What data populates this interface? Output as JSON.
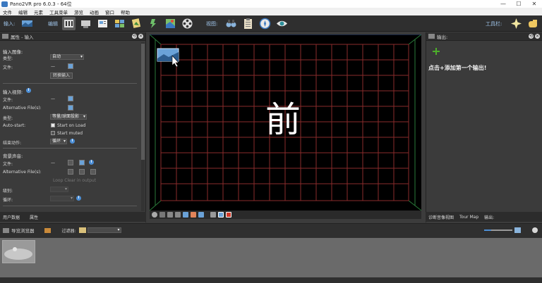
{
  "window": {
    "title": "Pano2VR pro 6.0.3 - 64位",
    "minimize": "—",
    "maximize": "☐",
    "close": "✕"
  },
  "menu": [
    "文件",
    "编辑",
    "元素",
    "工具菜单",
    "游览",
    "动画",
    "窗口",
    "帮助"
  ],
  "toolbar": {
    "input_label": "输入:",
    "edit_label": "编辑",
    "view_label": "视图:",
    "tools_label": "工具栏:"
  },
  "left_panel": {
    "title": "属性 - 输入",
    "input_image": {
      "heading": "输入图像:",
      "type_label": "类型:",
      "type_value": "自动",
      "file_label": "文件:",
      "file_value": "—",
      "convert_button": "转换输入"
    },
    "input_video": {
      "heading": "输入视频:",
      "file_label": "文件:",
      "file_value": "—",
      "alt_label": "Alternative File(s):",
      "type_label": "类型:",
      "type_value": "等量/球面投影",
      "autostart_label": "Auto-start:",
      "start_on_load": "Start on Load",
      "start_muted": "Start muted",
      "end_action_label": "结束动作:",
      "end_action_value": "循环"
    },
    "background_sound": {
      "heading": "背景声音:",
      "file_label": "文件:",
      "file_value": "—",
      "alt_label": "Alternative File(s):",
      "loop_hint": "Loop Clear in output",
      "level_label": "级别:",
      "loop_label": "循环:"
    },
    "tabs": [
      "用户数据",
      "属性"
    ]
  },
  "viewport": {
    "face_label": "前"
  },
  "right_panel": {
    "title": "输出:",
    "add_icon": "plus-icon",
    "hint": "点击+添加第一个输出!",
    "tabs": [
      "诊断音像视图",
      "Tour Map",
      "输出:"
    ]
  },
  "browser": {
    "title": "导览浏览器",
    "filter_label": "过滤器:"
  },
  "colors": {
    "accent": "#4d8fd6",
    "grid": "#8a2b2b",
    "add_green": "#4caf2a"
  }
}
